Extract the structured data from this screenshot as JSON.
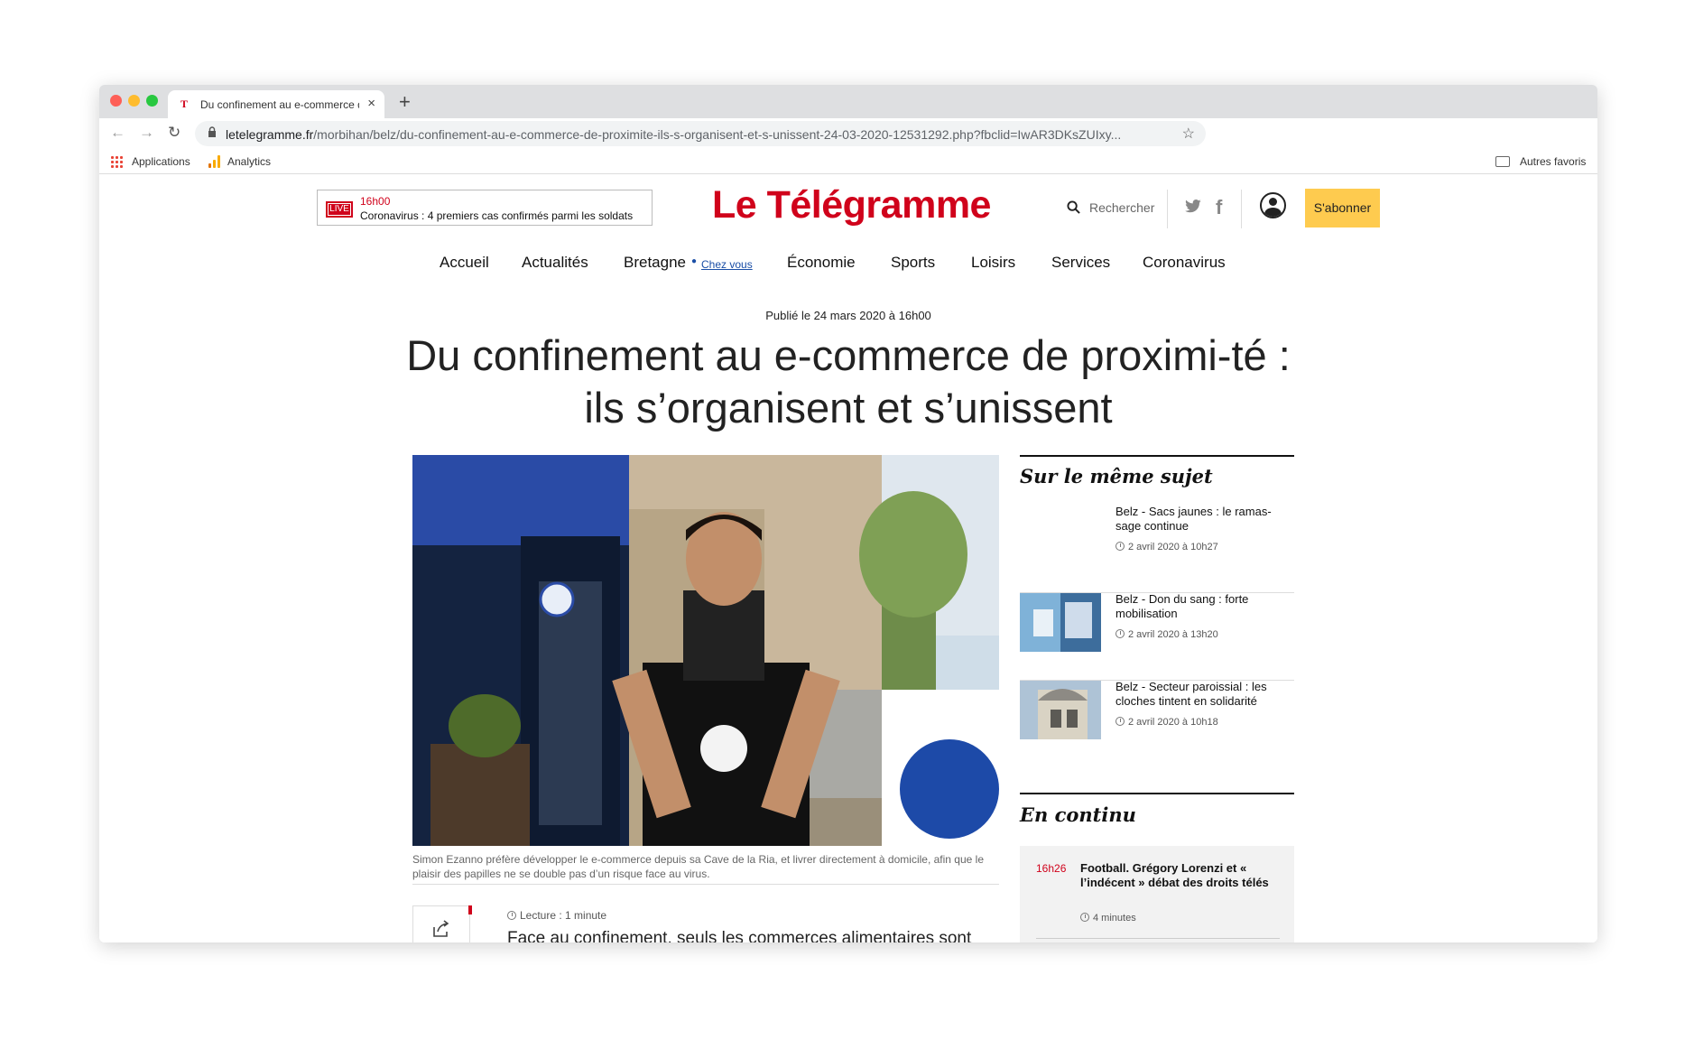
{
  "browser": {
    "tab_favicon": "T",
    "tab_title": "Du confinement au e-commerce de proximité",
    "tab_close": "×",
    "new_tab": "+",
    "url_host": "letelegramme.fr",
    "url_path": "/morbihan/belz/du-confinement-au-e-commerce-de-proximite-ils-s-organisent-et-s-unissent-24-03-2020-12531292.php?fbclid=IwAR3DKsZUIxy...",
    "bookmarks": {
      "apps": "Applications",
      "analytics": "Analytics",
      "others": "Autres favoris"
    }
  },
  "header": {
    "live_badge": "LIVE",
    "live_time": "16h00",
    "live_text": "Coronavirus : 4 premiers cas confirmés parmi les soldats",
    "logo": "Le Télégramme",
    "search_label": "Rechercher",
    "subscribe_label": "S'abonner"
  },
  "nav": {
    "items": [
      "Accueil",
      "Actualités",
      "Bretagne",
      "Économie",
      "Sports",
      "Loisirs",
      "Services",
      "Coronavirus"
    ],
    "chez_vous": "Chez vous"
  },
  "article": {
    "published": "Publié le 24 mars 2020 à 16h00",
    "headline": "Du confinement au e-commerce de proximi-té : ils s’organisent et s’unissent",
    "caption": "Simon Ezanno préfère développer le e-commerce depuis sa Cave de la Ria, et livrer directement à domicile, afin que le plaisir des papilles ne se double pas d’un risque face au virus.",
    "reading_time": "Lecture : 1 minute",
    "lead": "Face au confinement, seuls les commerces alimentaires sont"
  },
  "sidebar": {
    "related_title": "Sur le même sujet",
    "related": [
      {
        "title": "Belz - Sacs jaunes : le ramas-sage continue",
        "time": "2 avril 2020 à 10h27",
        "has_thumb": false
      },
      {
        "title": "Belz - Don du sang : forte mobilisation",
        "time": "2 avril 2020 à 13h20",
        "has_thumb": true
      },
      {
        "title": "Belz - Secteur paroissial : les cloches tintent en solidarité",
        "time": "2 avril 2020 à 10h18",
        "has_thumb": true
      }
    ],
    "continu_title": "En continu",
    "continu": [
      {
        "time": "16h26",
        "title": "Football. Grégory Lorenzi et « l’indécent » débat des droits télés",
        "duration": "4 minutes"
      }
    ]
  },
  "colors": {
    "brand": "#d0021b",
    "subscribe": "#fecb4f",
    "link": "#1a4ea6"
  }
}
